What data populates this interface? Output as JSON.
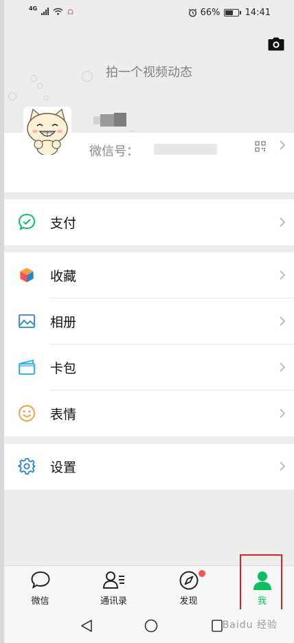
{
  "status_bar": {
    "network_label": "4G",
    "battery_text": "66%",
    "battery_level": 0.66,
    "time": "14:41"
  },
  "header": {
    "video_prompt": "拍一个视频动态",
    "camera_icon": "camera-icon"
  },
  "profile": {
    "wechat_id_label": "微信号：",
    "qr_icon": "qr-code-icon"
  },
  "menu": {
    "section1": [
      {
        "label": "支付",
        "icon": "pay-icon",
        "color": "#07c160"
      }
    ],
    "section2": [
      {
        "label": "收藏",
        "icon": "favorites-icon",
        "color": "#fa9d3b"
      },
      {
        "label": "相册",
        "icon": "album-icon",
        "color": "#2782d7"
      },
      {
        "label": "卡包",
        "icon": "card-wallet-icon",
        "color": "#10aeff"
      },
      {
        "label": "表情",
        "icon": "sticker-icon",
        "color": "#fa9d3b"
      }
    ],
    "section3": [
      {
        "label": "设置",
        "icon": "settings-icon",
        "color": "#2782d7"
      }
    ]
  },
  "tabs": [
    {
      "label": "微信",
      "icon": "chat-icon",
      "active": false
    },
    {
      "label": "通讯录",
      "icon": "contacts-icon",
      "active": false
    },
    {
      "label": "发现",
      "icon": "discover-icon",
      "active": false,
      "badge": true
    },
    {
      "label": "我",
      "icon": "me-icon",
      "active": true
    }
  ],
  "nav_bar": {
    "watermark": "Baidu 经验"
  },
  "colors": {
    "accent": "#07c160",
    "highlight_border": "#e02020",
    "badge": "#fa5151",
    "background": "#ededed"
  }
}
